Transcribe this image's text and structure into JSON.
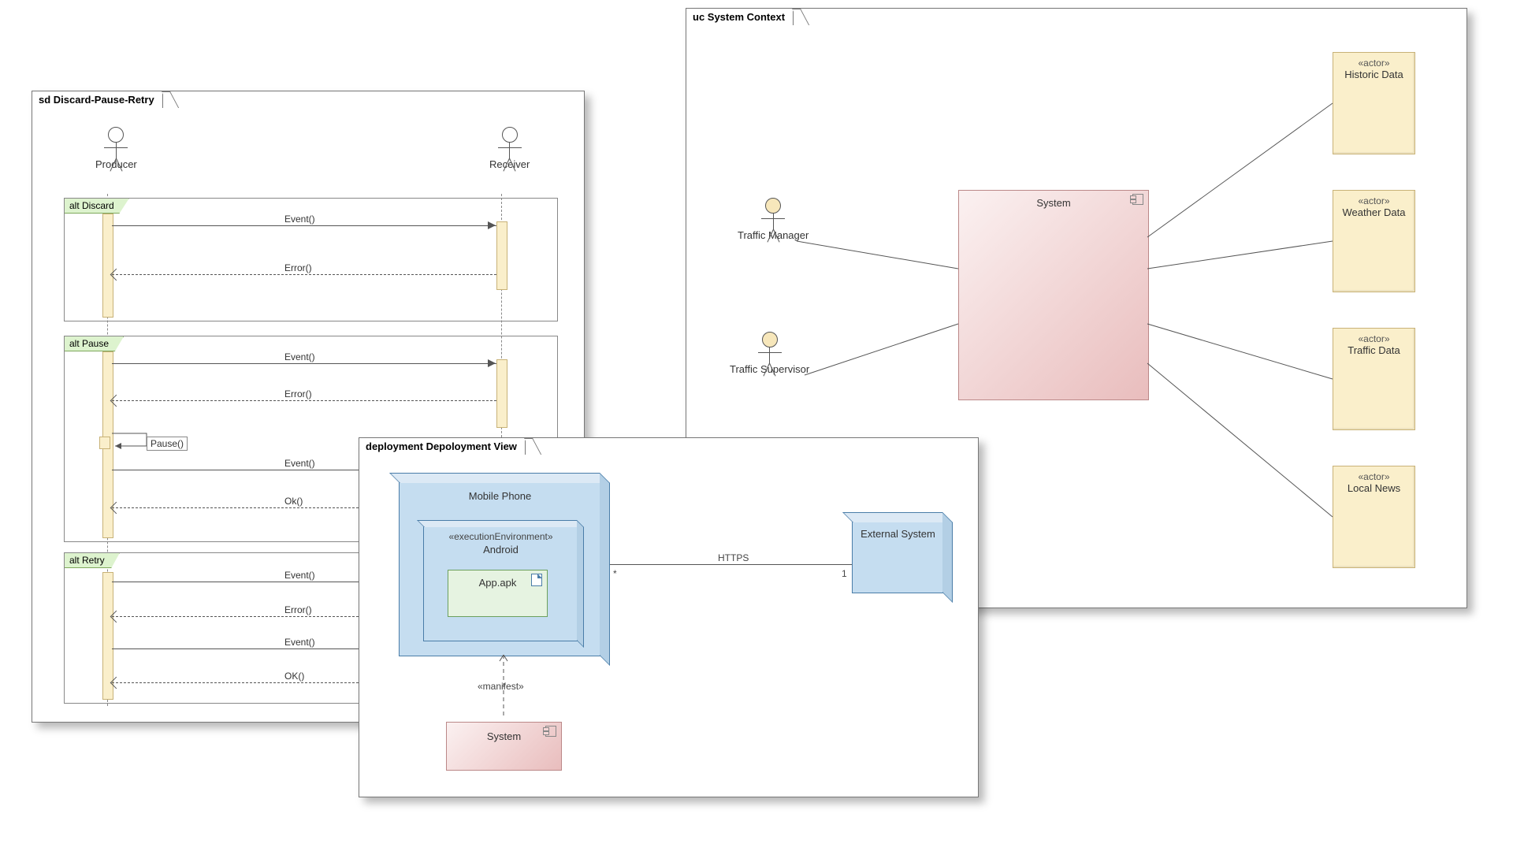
{
  "context": {
    "title": "uc System Context",
    "system": "System",
    "actors_left": [
      "Traffic Manager",
      "Traffic Supervisor"
    ],
    "actors_right": [
      {
        "stereo": "«actor»",
        "name": "Historic Data"
      },
      {
        "stereo": "«actor»",
        "name": "Weather Data"
      },
      {
        "stereo": "«actor»",
        "name": "Traffic Data"
      },
      {
        "stereo": "«actor»",
        "name": "Local News"
      }
    ]
  },
  "sequence": {
    "title": "sd Discard-Pause-Retry",
    "lifelines": [
      "Producer",
      "Receiver"
    ],
    "fragments": [
      {
        "label": "alt Discard",
        "messages": [
          {
            "text": "Event()",
            "dir": "r",
            "style": "solid"
          },
          {
            "text": "Error()",
            "dir": "l",
            "style": "dashed"
          }
        ]
      },
      {
        "label": "alt Pause",
        "messages": [
          {
            "text": "Event()",
            "dir": "r",
            "style": "solid"
          },
          {
            "text": "Error()",
            "dir": "l",
            "style": "dashed"
          },
          {
            "text": "Pause()",
            "dir": "self",
            "style": "solid"
          },
          {
            "text": "Event()",
            "dir": "r",
            "style": "solid"
          },
          {
            "text": "Ok()",
            "dir": "l",
            "style": "dashed"
          }
        ]
      },
      {
        "label": "alt Retry",
        "messages": [
          {
            "text": "Event()",
            "dir": "r",
            "style": "solid"
          },
          {
            "text": "Error()",
            "dir": "l",
            "style": "dashed"
          },
          {
            "text": "Event()",
            "dir": "r",
            "style": "solid"
          },
          {
            "text": "OK()",
            "dir": "l",
            "style": "dashed"
          }
        ]
      }
    ]
  },
  "deployment": {
    "title": "deployment Depoloyment View",
    "phone": "Mobile Phone",
    "env_stereo": "«executionEnvironment»",
    "env_name": "Android",
    "artifact": "App.apk",
    "manifest": "«manifest»",
    "system_comp": "System",
    "external": "External System",
    "link_label": "HTTPS",
    "mult_left": "*",
    "mult_right": "1"
  }
}
